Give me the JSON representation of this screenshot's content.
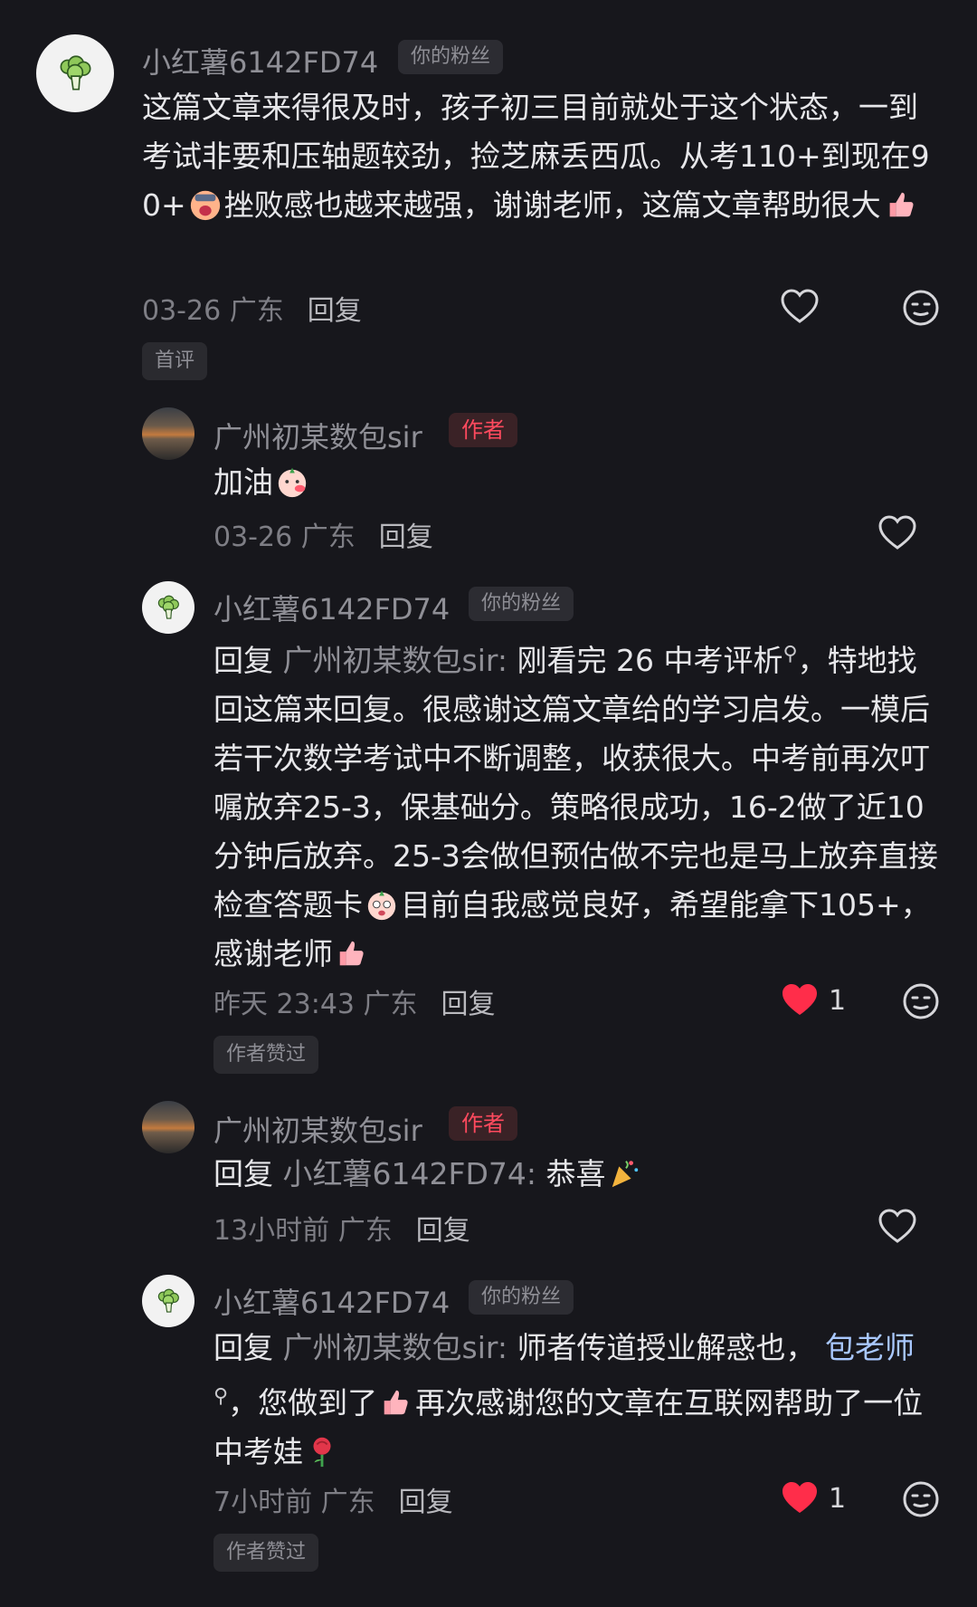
{
  "comments": [
    {
      "user": "小红薯6142FD74",
      "badge": "你的粉丝",
      "text_parts": [
        "这篇文章来得很及时，孩子初三目前就处于这个状态，一到考试非要和压轴题较劲，捡芝麻丢西瓜。从考110+到现在90+",
        "挫败感也越来越强，谢谢老师，这篇文章帮助很大"
      ],
      "meta_time": "03-26 广东",
      "reply": "回复",
      "tag": "首评"
    },
    {
      "user": "广州初某数包sir",
      "badge": "作者",
      "text": "加油",
      "meta_time": "03-26 广东",
      "reply": "回复"
    },
    {
      "user": "小红薯6142FD74",
      "badge": "你的粉丝",
      "reply_prefix": "回复",
      "reply_target": "广州初某数包sir:",
      "text_parts": [
        "刚看完 26 中考评析",
        "，特地找回这篇来回复。很感谢这篇文章给的学习启发。一模后若干次数学考试中不断调整，收获很大。中考前再次叮嘱放弃25-3，保基础分。策略很成功，16-2做了近10分钟后放弃。25-3会做但预估做不完也是马上放弃直接检查答题卡",
        "目前自我感觉良好，希望能拿下105+，感谢老师"
      ],
      "meta_time": "昨天 23:43 广东",
      "reply": "回复",
      "likes": "1",
      "tag": "作者赞过"
    },
    {
      "user": "广州初某数包sir",
      "badge": "作者",
      "reply_prefix": "回复",
      "reply_target": "小红薯6142FD74:",
      "text": "恭喜",
      "meta_time": "13小时前 广东",
      "reply": "回复"
    },
    {
      "user": "小红薯6142FD74",
      "badge": "你的粉丝",
      "reply_prefix": "回复",
      "reply_target": "广州初某数包sir:",
      "text_parts": [
        "师者传道授业解惑也，",
        "包老师",
        "，您做到了",
        "再次感谢您的文章在互联网帮助了一位中考娃"
      ],
      "meta_time": "7小时前 广东",
      "reply": "回复",
      "likes": "1",
      "tag": "作者赞过"
    }
  ],
  "icons": {
    "like": "heart-outline-icon",
    "liked": "heart-filled-icon",
    "emoji": "emoji-face-icon",
    "avatar_fan": "broccoli-avatar-icon",
    "avatar_author": "sunset-avatar"
  },
  "colors": {
    "background": "#17171c",
    "liked": "#ff2d4a",
    "author_badge": "#ff4a5e"
  }
}
